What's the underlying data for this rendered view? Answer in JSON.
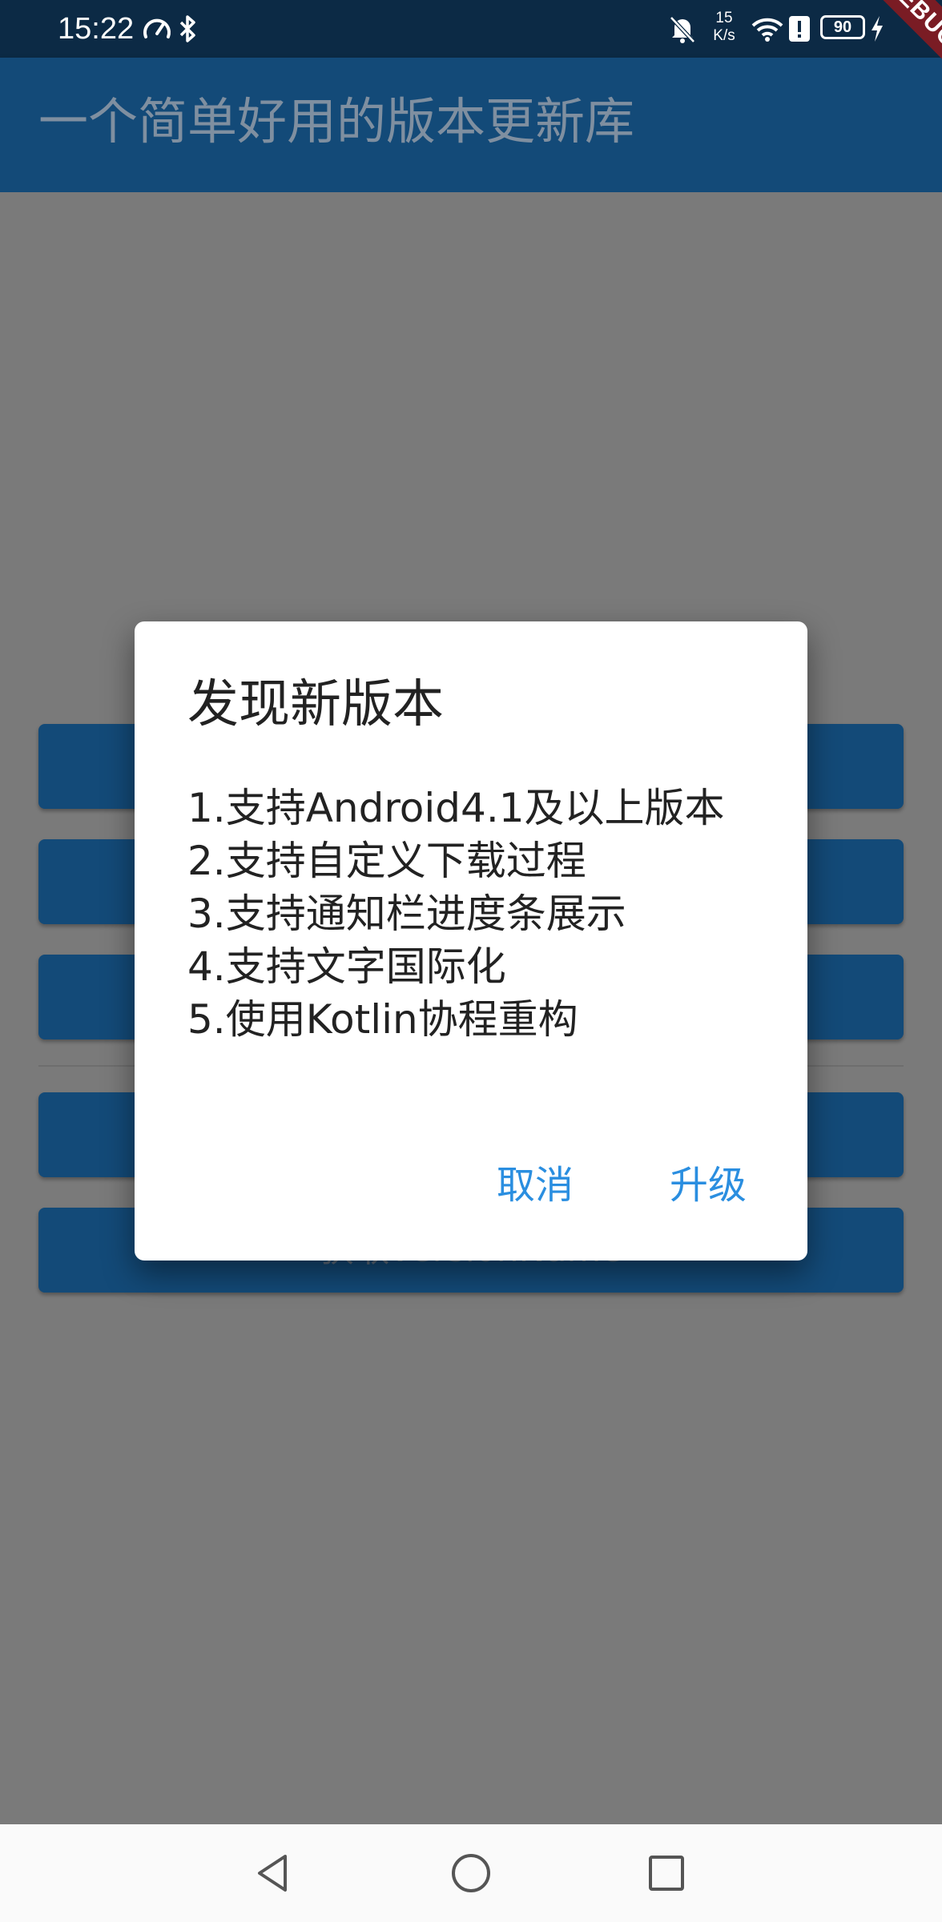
{
  "status_bar": {
    "time": "15:22",
    "net_speed_value": "15",
    "net_speed_unit": "K/s",
    "battery": "90",
    "icons": [
      "speed-gauge-icon",
      "bluetooth-icon",
      "notifications-off-icon",
      "wifi-icon",
      "alert-icon",
      "battery-icon",
      "charging-icon"
    ]
  },
  "app_bar": {
    "title": "一个简单好用的版本更新库"
  },
  "main": {
    "buttons": [
      {
        "label": ""
      },
      {
        "label": ""
      },
      {
        "label": ""
      },
      {
        "label": ""
      },
      {
        "label": "获取versionName"
      }
    ]
  },
  "dialog": {
    "title": "发现新版本",
    "lines": [
      "1.支持Android4.1及以上版本",
      "2.支持自定义下载过程",
      "3.支持通知栏进度条展示",
      "4.支持文字国际化",
      "5.使用Kotlin协程重构"
    ],
    "cancel_label": "取消",
    "upgrade_label": "升级",
    "accent_color": "#2a8ee0"
  },
  "debug_banner": {
    "label": "DEBUG"
  },
  "nav_bar": {
    "icons": [
      "back-icon",
      "home-icon",
      "recents-icon"
    ]
  },
  "colors": {
    "app_bar": "#134a78",
    "status_bar": "#0c2a45",
    "scrim_content": "#7a7a7a",
    "debug_banner": "#7a1c24"
  }
}
